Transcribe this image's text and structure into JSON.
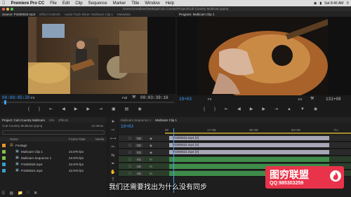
{
  "menu": {
    "app": "Premiere Pro CC",
    "items": [
      "File",
      "Edit",
      "Clip",
      "Sequence",
      "Marker",
      "Title",
      "Window",
      "Help"
    ],
    "clock": "Sat 8:46 AM"
  },
  "window_title": "/Users/Jonathan/Desktop/Cub Country/Project/Cub Country Multicam.prproj",
  "source": {
    "tabs": [
      "Source: P1000020.mp4",
      "Effect Controls",
      "Audio Track Mixer: Multicam Clip 1",
      "Metadata"
    ],
    "timecode_in": "00:00:05:20",
    "fit": "Fit",
    "quality": "Full",
    "timecode_out": "00:03:39:16"
  },
  "program": {
    "tab": "Program: Multicam Clip 1",
    "timecode": "10+03",
    "fit": "Fit",
    "fraction": "1/4",
    "duration": "131+08"
  },
  "project": {
    "tabs": [
      "Project: Cub Country Multicam",
      "Info",
      "Effects"
    ],
    "name": "Cub Country Multicam.prproj",
    "count": "12 Items",
    "headers": [
      "Name",
      "Frame Rate",
      "Media"
    ],
    "items": [
      {
        "name": "Footage",
        "rate": "",
        "color": "#e8932a",
        "folder": true
      },
      {
        "name": "Multicam Clip 1",
        "rate": "23.976 fps",
        "color": "#7fc24e",
        "folder": false
      },
      {
        "name": "Multicam Sequence 1",
        "rate": "23.976 fps",
        "color": "#7fc24e",
        "folder": false
      },
      {
        "name": "P1000020.mp4",
        "rate": "23.976 fps",
        "color": "#3b9ec9",
        "folder": false
      },
      {
        "name": "P1000021.mp4",
        "rate": "23.976 fps",
        "color": "#3b9ec9",
        "folder": false
      }
    ]
  },
  "timeline": {
    "tabs": [
      "Multicam Sequence 1",
      "Multicam Clip 1"
    ],
    "timecode": "10+03",
    "ruler": [
      "00",
      "17+08",
      "35+08",
      "53+08",
      "71+"
    ],
    "tracks": [
      "V3",
      "V2",
      "V1",
      "A1",
      "A2",
      "A3"
    ],
    "clips": [
      "P1000023.mp4 [V]",
      "P1000022.mp4 [V]",
      "P1000021.mp4 [V]"
    ]
  },
  "subtitle": "我们还需要找出为什么没有同步",
  "watermark": {
    "brand": "图穷联盟",
    "qq": "QQ:985303259"
  }
}
